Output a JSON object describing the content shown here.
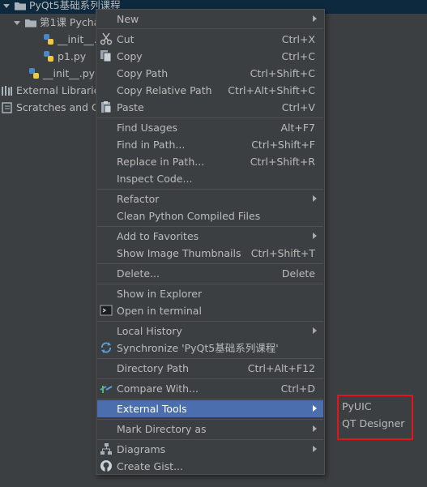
{
  "tree": {
    "root": "PyQt5基础系列课程",
    "folder": "第1课 Pycha",
    "init_file_1": "__init__.p",
    "p1_file": "p1.py",
    "init_file_2": "__init__.py",
    "external_libraries": "External Libraries",
    "scratches": "Scratches and Co"
  },
  "menu": {
    "new": {
      "label": "New"
    },
    "cut": {
      "label": "Cut",
      "shortcut": "Ctrl+X"
    },
    "copy": {
      "label": "Copy",
      "shortcut": "Ctrl+C"
    },
    "copy_path": {
      "label": "Copy Path",
      "shortcut": "Ctrl+Shift+C"
    },
    "copy_relative_path": {
      "label": "Copy Relative Path",
      "shortcut": "Ctrl+Alt+Shift+C"
    },
    "paste": {
      "label": "Paste",
      "shortcut": "Ctrl+V"
    },
    "find_usages": {
      "label": "Find Usages",
      "shortcut": "Alt+F7"
    },
    "find_in_path": {
      "label": "Find in Path...",
      "shortcut": "Ctrl+Shift+F"
    },
    "replace_in_path": {
      "label": "Replace in Path...",
      "shortcut": "Ctrl+Shift+R"
    },
    "inspect_code": {
      "label": "Inspect Code..."
    },
    "refactor": {
      "label": "Refactor"
    },
    "clean_python": {
      "label": "Clean Python Compiled Files"
    },
    "add_to_favorites": {
      "label": "Add to Favorites"
    },
    "show_thumbnails": {
      "label": "Show Image Thumbnails",
      "shortcut": "Ctrl+Shift+T"
    },
    "delete": {
      "label": "Delete...",
      "shortcut": "Delete"
    },
    "show_in_explorer": {
      "label": "Show in Explorer"
    },
    "open_in_terminal": {
      "label": "Open in terminal"
    },
    "local_history": {
      "label": "Local History"
    },
    "synchronize": {
      "label": "Synchronize 'PyQt5基础系列课程'"
    },
    "directory_path": {
      "label": "Directory Path",
      "shortcut": "Ctrl+Alt+F12"
    },
    "compare_with": {
      "label": "Compare With...",
      "shortcut": "Ctrl+D"
    },
    "external_tools": {
      "label": "External Tools"
    },
    "mark_directory": {
      "label": "Mark Directory as"
    },
    "diagrams": {
      "label": "Diagrams"
    },
    "create_gist": {
      "label": "Create Gist..."
    }
  },
  "submenu": {
    "pyuic": "PyUIC",
    "qt_designer": "QT Designer"
  },
  "colors": {
    "background": "#3c3f41",
    "highlight": "#4b6eaf",
    "annotation": "#e5141b"
  }
}
